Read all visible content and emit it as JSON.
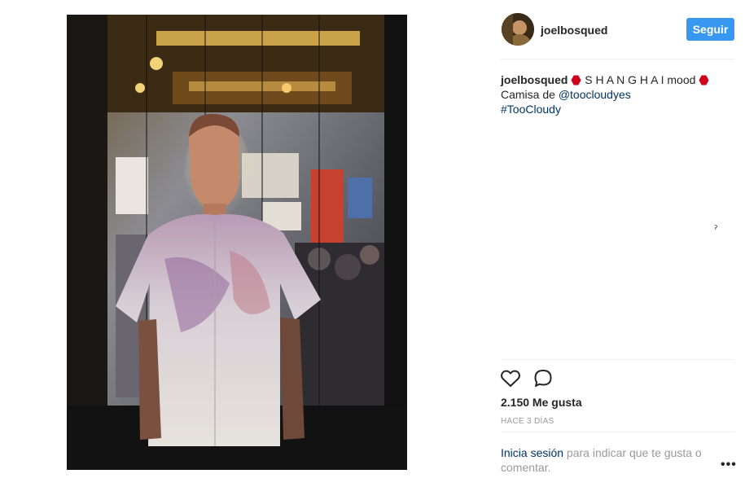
{
  "post": {
    "username": "joelbosqued",
    "follow_label": "Seguir",
    "caption": {
      "username": "joelbosqued",
      "emoji_left": "hexagon-emoji",
      "text_main": "S H A N G H A I mood",
      "emoji_right": "hexagon-emoji",
      "line2_prefix": "Camisa de ",
      "mention": "@toocloudyes",
      "hashtag": "#TooCloudy"
    },
    "stray_char": "ॽ",
    "likes": "2.150 Me gusta",
    "date": "HACE 3 DÍAS",
    "login_link": "Inicia sesión",
    "login_text": " para indicar que te gusta o comentar.",
    "more_label": "•••"
  },
  "icons": {
    "like": "heart-icon",
    "comment": "comment-icon",
    "emoji": "red-hexagon"
  },
  "colors": {
    "follow_bg": "#3897f0",
    "link": "#003569",
    "muted": "#999999",
    "emoji_red": "#d0021b"
  }
}
